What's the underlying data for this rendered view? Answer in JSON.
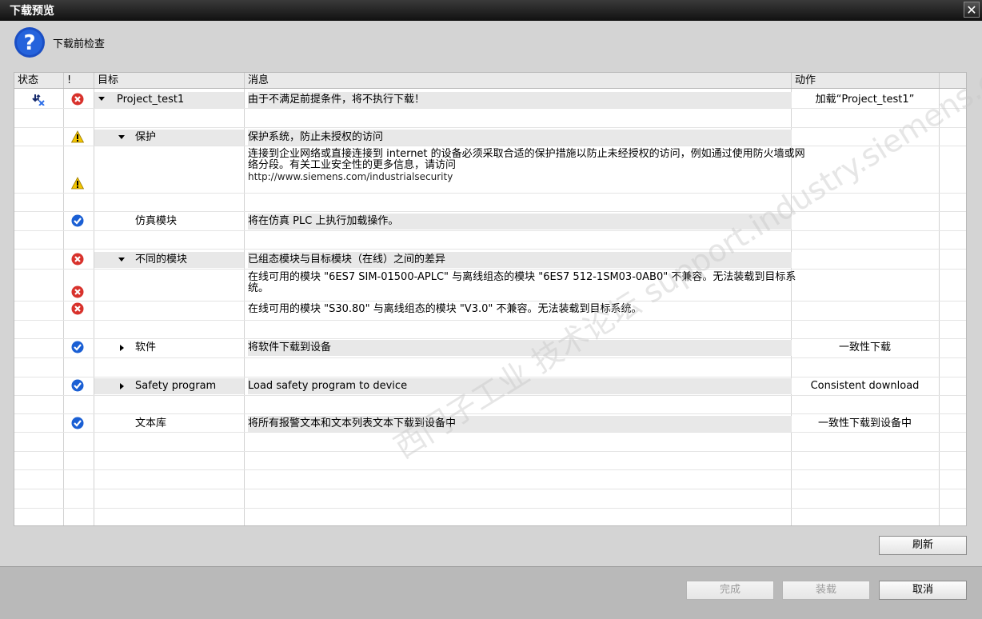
{
  "window": {
    "title": "下载预览",
    "close_glyph": "✕"
  },
  "header": {
    "label": "下载前检查",
    "icon": "question-icon"
  },
  "columns": {
    "status": "状态",
    "bang": "!",
    "target": "目标",
    "message": "消息",
    "action": "动作"
  },
  "rows": [
    {
      "status_icon": "download-blocked-icon",
      "severity": "error",
      "expand": "expanded",
      "target": "Project_test1",
      "message": "由于不满足前提条件，将不执行下载！",
      "action": "加载“Project_test1”"
    },
    {
      "severity": "warning",
      "expand": "expanded",
      "target": "保护",
      "message": "保护系统，防止未授权的访问",
      "action": ""
    },
    {
      "severity": "warning",
      "target": "",
      "message": "连接到企业网络或直接连接到 internet 的设备必须采取合适的保护措施以防止未经授权的访问，例如通过使用防火墙或网络分段。有关工业安全性的更多信息，请访问",
      "url": "http://www.siemens.com/industrialsecurity",
      "action": ""
    },
    {
      "severity": "ok",
      "target": "仿真模块",
      "message": "将在仿真 PLC 上执行加载操作。",
      "action": ""
    },
    {
      "severity": "error",
      "expand": "expanded",
      "target": "不同的模块",
      "message": "已组态模块与目标模块（在线）之间的差异",
      "action": ""
    },
    {
      "severity": "error",
      "target": "",
      "message": "在线可用的模块 \"6ES7 SIM-01500-APLC\" 与离线组态的模块 \"6ES7 512-1SM03-0AB0\" 不兼容。无法装载到目标系统。",
      "action": ""
    },
    {
      "severity": "error",
      "target": "",
      "message": "在线可用的模块 \"S30.80\" 与离线组态的模块 \"V3.0\" 不兼容。无法装载到目标系统。",
      "action": ""
    },
    {
      "severity": "ok",
      "expand": "collapsed",
      "target": "软件",
      "message": "将软件下载到设备",
      "action": "一致性下载"
    },
    {
      "severity": "ok",
      "expand": "collapsed",
      "target": "Safety program",
      "message": "Load safety program to device",
      "action": "Consistent download"
    },
    {
      "severity": "ok",
      "target": "文本库",
      "message": "将所有报警文本和文本列表文本下载到设备中",
      "action": "一致性下载到设备中"
    }
  ],
  "buttons": {
    "refresh": "刷新",
    "finish": "完成",
    "load": "装载",
    "cancel": "取消"
  },
  "watermark": "西门子工业 技术论坛 support.industry.siemens.com/cs",
  "colors": {
    "error": "#d8322c",
    "warning": "#f3c500",
    "ok": "#1a5fd4",
    "title_bar": "#1a1a1a"
  }
}
